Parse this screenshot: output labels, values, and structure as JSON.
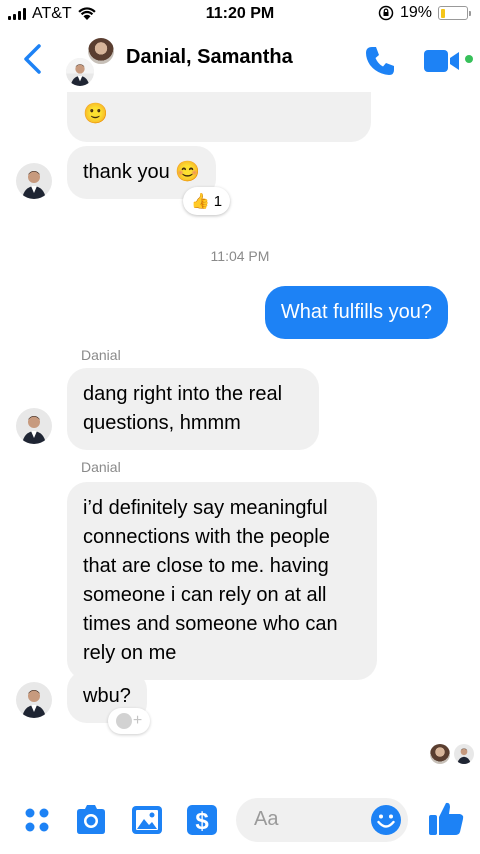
{
  "status_bar": {
    "carrier": "AT&T",
    "time": "11:20 PM",
    "battery": "19%",
    "battery_level": 0.19
  },
  "header": {
    "title": "Danial, Samantha",
    "back_icon": "chevron-left-icon",
    "call_icon": "phone-icon",
    "video_icon": "video-camera-icon"
  },
  "thread": {
    "messages": [
      {
        "id": "m0",
        "sender": "Danial",
        "direction": "in",
        "text": "🙂"
      },
      {
        "id": "m1",
        "sender": "Danial",
        "direction": "in",
        "text": "thank you 😊",
        "reaction": {
          "emoji": "👍",
          "count": "1"
        }
      },
      {
        "id": "m2",
        "direction": "out",
        "text": "What fulfills you?"
      },
      {
        "id": "m3",
        "sender": "Danial",
        "direction": "in",
        "text": "dang right into the real questions, hmmm"
      },
      {
        "id": "m4",
        "sender": "Danial",
        "direction": "in",
        "text": "i’d definitely say meaningful connections with the people that are close to me. having someone i can rely on at all times and someone who can rely on me"
      },
      {
        "id": "m5",
        "sender": "Danial",
        "direction": "in",
        "text": "wbu?"
      }
    ],
    "timestamp": "11:04 PM",
    "sender_label_1": "Danial",
    "sender_label_2": "Danial",
    "add_reaction_glyph": "+"
  },
  "composer": {
    "placeholder": "Aa",
    "buttons": [
      "apps-icon",
      "camera-icon",
      "photo-icon",
      "payment-icon",
      "emoji-icon",
      "thumbs-up-icon"
    ]
  },
  "colors": {
    "accent": "#1d82f5",
    "incoming_bubble": "#f0f0f0",
    "online": "#37c05a",
    "battery": "#f5c518"
  }
}
